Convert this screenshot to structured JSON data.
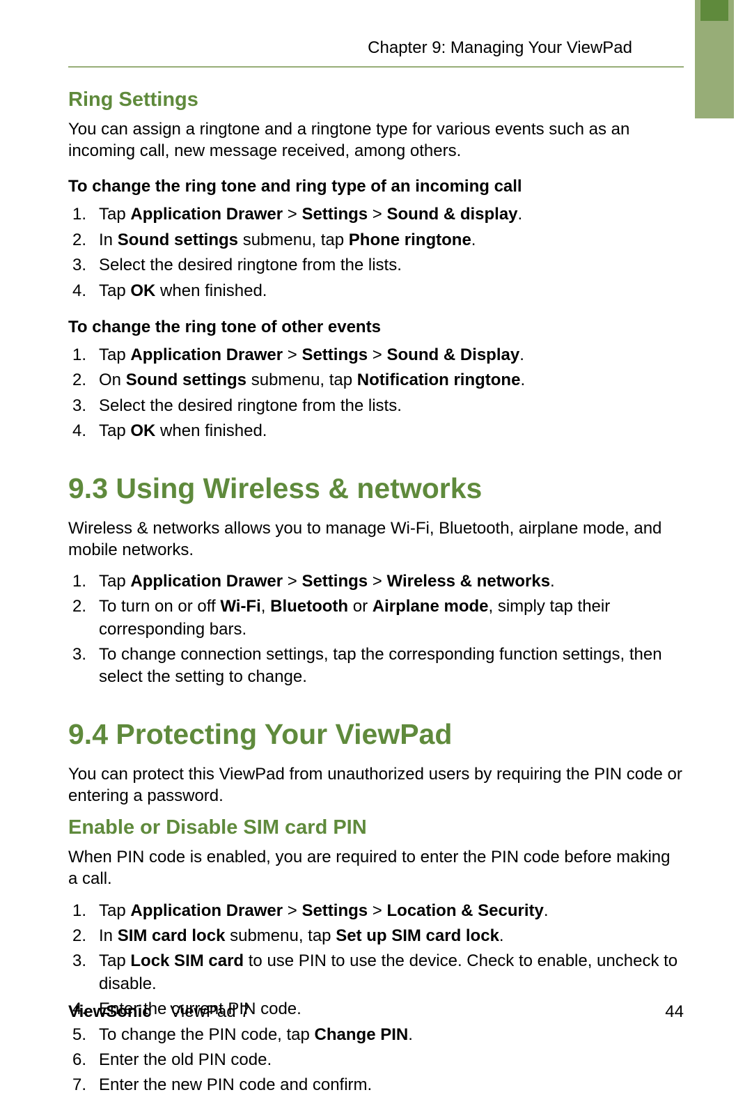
{
  "header": {
    "chapter": "Chapter 9: Managing Your ViewPad"
  },
  "sec_ring": {
    "title": "Ring Settings",
    "intro": "You can assign a ringtone and a ringtone type for various events such as an incoming call, new message received, among others.",
    "sub1_title": "To change the ring tone and ring type of an incoming call",
    "sub1_steps": [
      {
        "pre": "Tap ",
        "b1": "Application Drawer",
        "mid1": " > ",
        "b2": "Settings",
        "mid2": " > ",
        "b3": "Sound & display",
        "post": "."
      },
      {
        "pre": "In ",
        "b1": "Sound settings",
        "mid1": " submenu, tap ",
        "b2": "Phone ringtone",
        "post": "."
      },
      {
        "pre": "Select the desired ringtone from the lists."
      },
      {
        "pre": "Tap ",
        "b1": "OK",
        "post": " when finished."
      }
    ],
    "sub2_title": "To change the ring tone of other events",
    "sub2_steps": [
      {
        "pre": "Tap ",
        "b1": "Application Drawer",
        "mid1": " > ",
        "b2": "Settings",
        "mid2": " > ",
        "b3": "Sound & Display",
        "post": "."
      },
      {
        "pre": "On ",
        "b1": "Sound settings",
        "mid1": " submenu, tap ",
        "b2": "Notification ringtone",
        "post": "."
      },
      {
        "pre": "Select the desired ringtone from the lists."
      },
      {
        "pre": "Tap ",
        "b1": "OK",
        "post": " when finished."
      }
    ]
  },
  "sec_wireless": {
    "title": "9.3 Using Wireless & networks",
    "intro": "Wireless & networks allows you to manage Wi-Fi, Bluetooth, airplane mode, and mobile networks.",
    "steps": [
      {
        "pre": "Tap ",
        "b1": "Application Drawer",
        "mid1": " > ",
        "b2": "Settings",
        "mid2": " > ",
        "b3": "Wireless & networks",
        "post": "."
      },
      {
        "pre": "To turn on or off ",
        "b1": "Wi-Fi",
        "mid1": ", ",
        "b2": "Bluetooth",
        "mid2": " or ",
        "b3": "Airplane mode",
        "post": ", simply tap their corresponding bars."
      },
      {
        "pre": "To change connection settings, tap the corresponding function settings, then select the setting to change."
      }
    ]
  },
  "sec_protect": {
    "title": "9.4 Protecting Your ViewPad",
    "intro": "You can protect this ViewPad from unauthorized users by requiring the PIN code or entering a password.",
    "sub_title": "Enable or Disable SIM card PIN",
    "sub_intro": "When PIN code is enabled, you are required to enter the PIN code before making a call.",
    "steps": [
      {
        "pre": "Tap ",
        "b1": "Application Drawer",
        "mid1": " > ",
        "b2": "Settings",
        "mid2": " > ",
        "b3": "Location & Security",
        "post": "."
      },
      {
        "pre": "In ",
        "b1": "SIM card lock",
        "mid1": " submenu, tap ",
        "b2": "Set up SIM card lock",
        "post": "."
      },
      {
        "pre": "Tap ",
        "b1": "Lock SIM card",
        "post": " to use PIN to use the device. Check to enable, uncheck to disable."
      },
      {
        "pre": "Enter the current PIN code."
      },
      {
        "pre": "To change the PIN code, tap ",
        "b1": "Change PIN",
        "post": "."
      },
      {
        "pre": "Enter the old PIN code."
      },
      {
        "pre": "Enter the new PIN code and confirm."
      }
    ]
  },
  "footer": {
    "brand_bold": "ViewSonic",
    "brand_rest": "ViewPad 7",
    "page_num": "44"
  }
}
